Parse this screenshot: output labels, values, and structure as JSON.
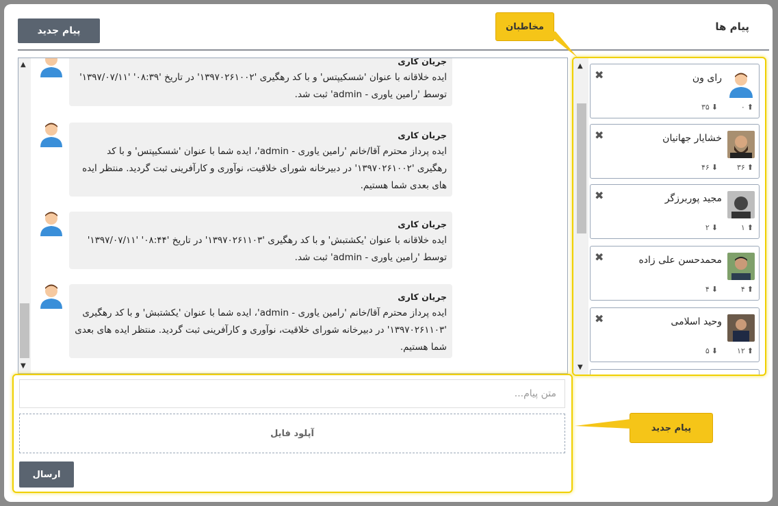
{
  "header": {
    "title": "پیام ها",
    "new_message_label": "پیام جدید"
  },
  "callouts": {
    "contacts": "مخاطبان",
    "new_message": "پیام جدید"
  },
  "messages": [
    {
      "sender": "جریان کاری",
      "text": "ایده خلاقانه با عنوان 'شسکیپتس' و با کد رهگیری '۱۳۹۷۰۲۶۱۰۰۲' در تاریخ '۰۸:۳۹' '۱۳۹۷/۰۷/۱۱' توسط 'رامین یاوری - admin' ثبت شد."
    },
    {
      "sender": "جریان کاری",
      "text": "ایده پرداز محترم آقا/خانم 'رامین یاوری - admin'، ایده شما با عنوان 'شسکیپتس' و با کد رهگیری '۱۳۹۷۰۲۶۱۰۰۲' در دبیرخانه شورای خلاقیت، نوآوری و کارآفرینی ثبت گردید. منتظر ایده های بعدی شما هستیم."
    },
    {
      "sender": "جریان کاری",
      "text": "ایده خلاقانه با عنوان 'یکشتبش' و با کد رهگیری '۱۳۹۷۰۲۶۱۱۰۳' در تاریخ '۰۸:۴۴' '۱۳۹۷/۰۷/۱۱' توسط 'رامین یاوری - admin' ثبت شد."
    },
    {
      "sender": "جریان کاری",
      "text": "ایده پرداز محترم آقا/خانم 'رامین یاوری - admin'، ایده شما با عنوان 'یکشتبش' و با کد رهگیری '۱۳۹۷۰۲۶۱۱۰۳' در دبیرخانه شورای خلاقیت، نوآوری و کارآفرینی ثبت گردید. منتظر ایده های بعدی شما هستیم."
    }
  ],
  "contacts": [
    {
      "name": "رای ون",
      "sent": "۰",
      "received": "۳۵",
      "photo": "default-avatar"
    },
    {
      "name": "خشایار جهانیان",
      "sent": "۳۶",
      "received": "۴۶",
      "photo": "photo"
    },
    {
      "name": "مجید پوربرزگر",
      "sent": "۱",
      "received": "۲",
      "photo": "photo"
    },
    {
      "name": "محمدحسن علی زاده",
      "sent": "۴",
      "received": "۴",
      "photo": "photo"
    },
    {
      "name": "وحید اسلامی",
      "sent": "۱۲",
      "received": "۵",
      "photo": "photo"
    }
  ],
  "compose": {
    "placeholder": "متن پیام...",
    "upload_label": "آپلود فایل",
    "send_label": "ارسال"
  },
  "colors": {
    "accent": "#5a6470",
    "highlight": "#f5c518",
    "border": "#9aa7b8"
  }
}
